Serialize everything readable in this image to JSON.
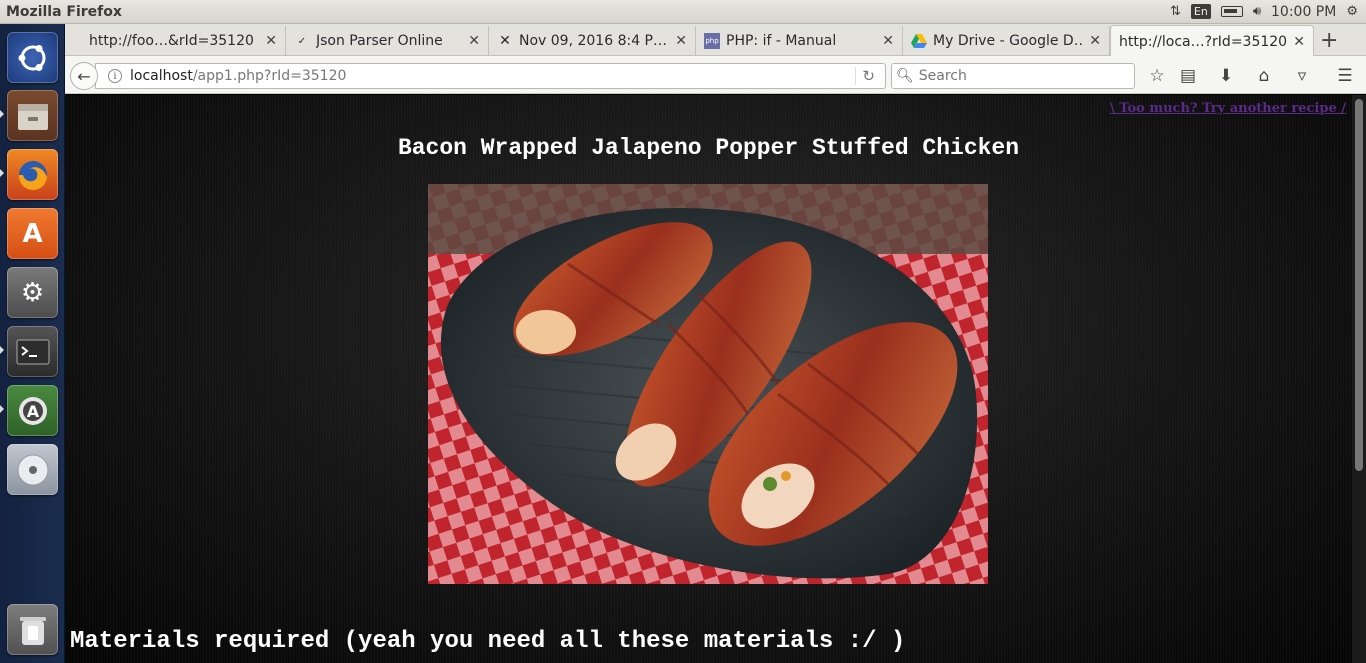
{
  "top_panel": {
    "app_title": "Mozilla Firefox",
    "keyboard_layout": "En",
    "clock": "10:00 PM"
  },
  "launcher": {
    "items": [
      {
        "name": "ubuntu-dash",
        "icon": "ubuntu-logo-icon",
        "color": "#2c4a8a"
      },
      {
        "name": "files",
        "icon": "file-cabinet-icon",
        "color": "#8a5a3a"
      },
      {
        "name": "firefox",
        "icon": "firefox-icon",
        "color": "#d7521b"
      },
      {
        "name": "software-center",
        "icon": "shopping-bag-icon",
        "color": "#e7641f"
      },
      {
        "name": "system-settings",
        "icon": "gear-wrench-icon",
        "color": "#5a5a5a"
      },
      {
        "name": "terminal",
        "icon": "terminal-icon",
        "color": "#3a3a3a"
      },
      {
        "name": "software-updater",
        "icon": "updater-icon",
        "color": "#3f7a3a"
      },
      {
        "name": "dvd",
        "icon": "disc-icon",
        "color": "#9ba4b0"
      },
      {
        "name": "trash",
        "icon": "trash-icon",
        "color": "#6a6a6a"
      }
    ]
  },
  "browser": {
    "tabs": [
      {
        "label": "http://foo…&rId=35120",
        "icon": "blank-page-icon"
      },
      {
        "label": "Json Parser Online",
        "icon": "json-icon"
      },
      {
        "label": "Nov 09, 2016 8:4 P…",
        "icon": "cross-arrows-icon"
      },
      {
        "label": "PHP: if - Manual",
        "icon": "php-icon"
      },
      {
        "label": "My Drive - Google D…",
        "icon": "google-drive-icon"
      },
      {
        "label": "http://loca…?rId=35120",
        "icon": "blank-page-icon",
        "active": true
      }
    ],
    "url_host": "localhost",
    "url_path": "/app1.php?rId=35120",
    "search_placeholder": "Search"
  },
  "page": {
    "alt_link": "\\ Too much? Try another recipe /",
    "recipe_title": "Bacon Wrapped Jalapeno Popper Stuffed Chicken",
    "materials_heading": "Materials required (yeah you need all these materials :/ )"
  }
}
